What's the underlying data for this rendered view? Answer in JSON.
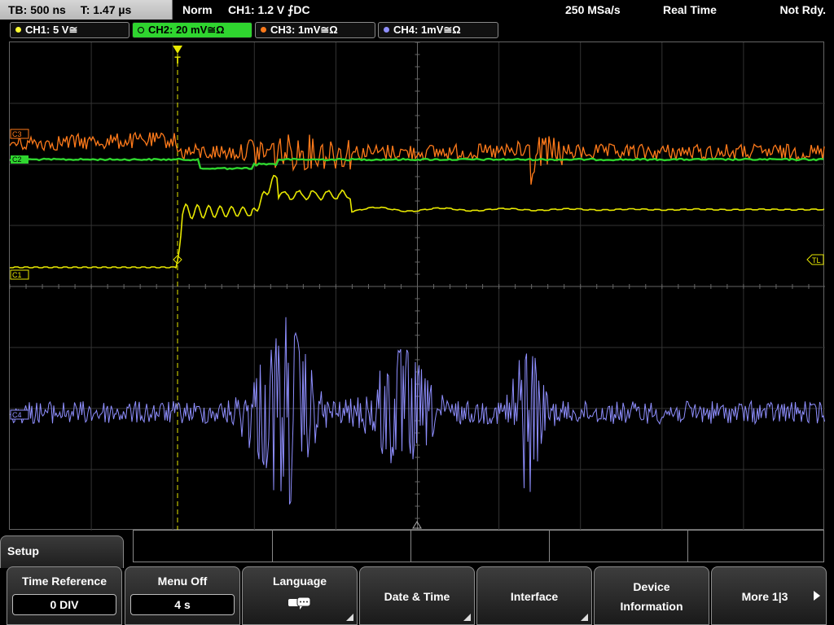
{
  "topbar": {
    "timebase": "TB: 500 ns",
    "trigger_time": "T: 1.47 µs",
    "trigger_mode": "Norm",
    "trigger_info": "CH1: 1.2 V ⨍DC",
    "sample_rate": "250 MSa/s",
    "acq_mode": "Real Time",
    "status": "Not Rdy."
  },
  "channels": [
    {
      "label": "CH1: 5 V≅",
      "color": "#ffff33",
      "active": false
    },
    {
      "label": "CH2: 20 mV≅Ω",
      "color": "#2fd52f",
      "active": true
    },
    {
      "label": "CH3: 1mV≅Ω",
      "color": "#ff7a1a",
      "active": false
    },
    {
      "label": "CH4: 1mV≅Ω",
      "color": "#8f8fff",
      "active": false
    }
  ],
  "screen": {
    "trigger_marker": "T",
    "trigger_level_marker": "TL",
    "ch1_marker": "C1",
    "ch2_marker": "C2",
    "ch3_marker": "C3",
    "ch4_marker": "C4"
  },
  "menu": {
    "title": "Setup",
    "softkeys": [
      {
        "title": "Time Reference",
        "value": "0 DIV"
      },
      {
        "title": "Menu Off",
        "value": "4 s"
      },
      {
        "title": "Language",
        "icon": "speech-bubbles-icon"
      },
      {
        "title": "Date & Time"
      },
      {
        "title": "Interface"
      },
      {
        "title": "Device",
        "title2": "Information"
      },
      {
        "title": "More 1|3",
        "icon": "play-arrow-icon"
      }
    ]
  }
}
